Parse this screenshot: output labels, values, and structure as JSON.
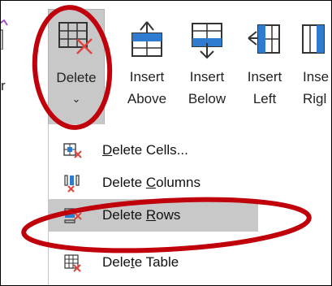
{
  "ribbon": {
    "partial_left_label": "r",
    "delete": {
      "label": "Delete",
      "chevron": "⌄"
    },
    "insert_above": {
      "line1": "Insert",
      "line2": "Above"
    },
    "insert_below": {
      "line1": "Insert",
      "line2": "Below"
    },
    "insert_left": {
      "line1": "Insert",
      "line2": "Left"
    },
    "insert_right": {
      "line1": "Inse",
      "line2": "Rigl"
    }
  },
  "menu": {
    "items": [
      {
        "pre": "",
        "ul": "D",
        "post": "elete Cells...",
        "icon": "delete-cells-icon"
      },
      {
        "pre": "Delete ",
        "ul": "C",
        "post": "olumns",
        "icon": "delete-columns-icon"
      },
      {
        "pre": "Delete ",
        "ul": "R",
        "post": "ows",
        "icon": "delete-rows-icon",
        "highlighted": true
      },
      {
        "pre": "Dele",
        "ul": "t",
        "post": "e Table",
        "icon": "delete-table-icon"
      }
    ]
  },
  "colors": {
    "annotation_red": "#c0000b",
    "icon_blue": "#2f7bd0",
    "delete_x_red": "#e0443e",
    "pressed_gray": "#c8c8c8"
  }
}
